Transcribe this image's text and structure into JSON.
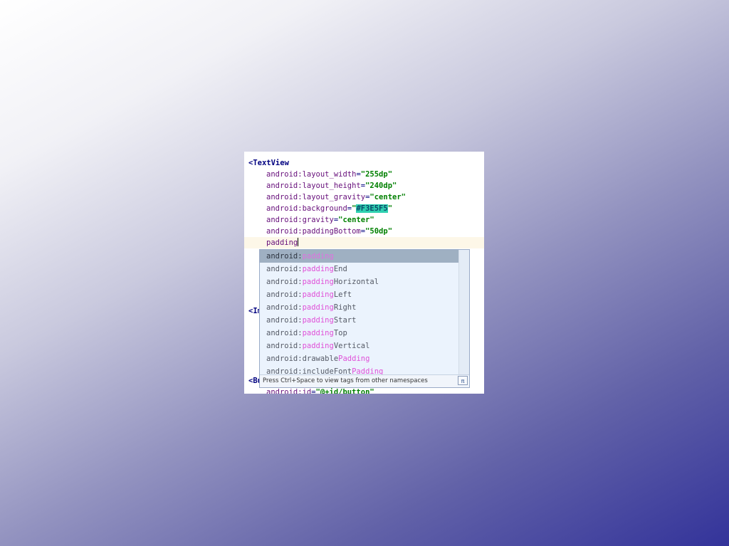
{
  "editor": {
    "lines": [
      {
        "kind": "tag",
        "text": "<TextView"
      },
      {
        "kind": "attr",
        "name": "android:layout_width",
        "value": "\"255dp\""
      },
      {
        "kind": "attr",
        "name": "android:layout_height",
        "value": "\"240dp\""
      },
      {
        "kind": "attr",
        "name": "android:layout_gravity",
        "value": "\"center\""
      },
      {
        "kind": "attr",
        "name": "android:background",
        "value_prefix": "\"",
        "value_hl": "#F3E5F5",
        "value_suffix": "\""
      },
      {
        "kind": "attr",
        "name": "android:gravity",
        "value": "\"center\""
      },
      {
        "kind": "attr",
        "name": "android:paddingBottom",
        "value": "\"50dp\""
      },
      {
        "kind": "typing",
        "text": "padding"
      }
    ],
    "hidden_line_1": "<Im",
    "hidden_line_2": "<Bu",
    "hidden_line_3_name": "android:id",
    "hidden_line_3_value": "\"@+id/button\""
  },
  "autocomplete": {
    "items": [
      {
        "prefix": "android:",
        "match": "padding",
        "suffix": ""
      },
      {
        "prefix": "android:",
        "match": "padding",
        "suffix": "End"
      },
      {
        "prefix": "android:",
        "match": "padding",
        "suffix": "Horizontal"
      },
      {
        "prefix": "android:",
        "match": "padding",
        "suffix": "Left"
      },
      {
        "prefix": "android:",
        "match": "padding",
        "suffix": "Right"
      },
      {
        "prefix": "android:",
        "match": "padding",
        "suffix": "Start"
      },
      {
        "prefix": "android:",
        "match": "padding",
        "suffix": "Top"
      },
      {
        "prefix": "android:",
        "match": "padding",
        "suffix": "Vertical"
      },
      {
        "prefix": "android:drawable",
        "match": "Padding",
        "suffix": ""
      },
      {
        "prefix": "android:includeFont",
        "match": "Padding",
        "suffix": ""
      }
    ],
    "selected_index": 0,
    "footer_hint": "Press Ctrl+Space to view tags from other namespaces",
    "pi_label": "π"
  }
}
